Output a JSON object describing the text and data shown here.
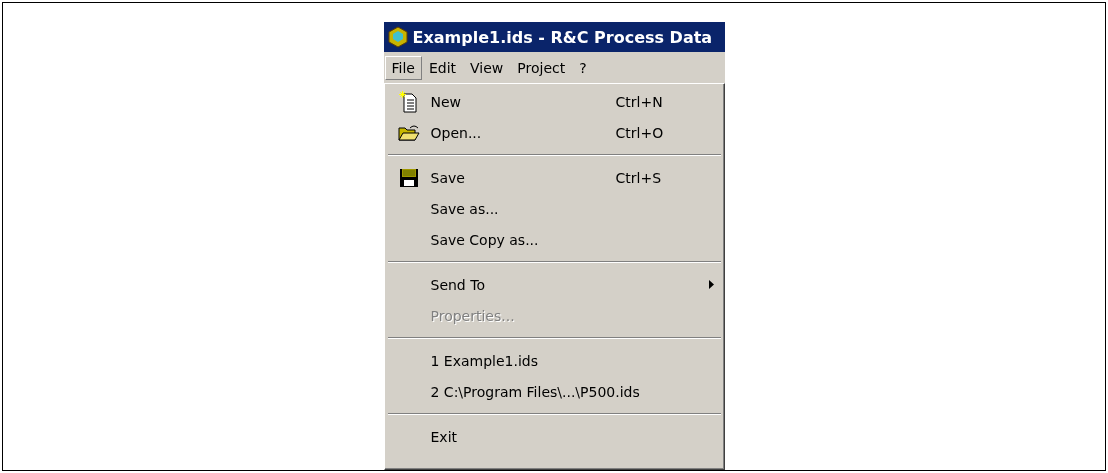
{
  "window": {
    "title": "Example1.ids - R&C Process Data"
  },
  "menubar": [
    {
      "label": "File",
      "selected": true
    },
    {
      "label": "Edit",
      "selected": false
    },
    {
      "label": "View",
      "selected": false
    },
    {
      "label": "Project",
      "selected": false
    },
    {
      "label": "?",
      "selected": false
    }
  ],
  "menu": [
    {
      "kind": "new",
      "label": "New",
      "shortcut": "Ctrl+N",
      "disabled": false,
      "submenu": false
    },
    {
      "kind": "open",
      "label": "Open...",
      "shortcut": "Ctrl+O",
      "disabled": false,
      "submenu": false
    },
    {
      "kind": "separator"
    },
    {
      "kind": "save",
      "label": "Save",
      "shortcut": "Ctrl+S",
      "disabled": false,
      "submenu": false
    },
    {
      "kind": "item",
      "label": "Save as...",
      "disabled": false,
      "submenu": false
    },
    {
      "kind": "item",
      "label": "Save Copy as...",
      "disabled": false,
      "submenu": false
    },
    {
      "kind": "separator"
    },
    {
      "kind": "item",
      "label": "Send To",
      "disabled": false,
      "submenu": true
    },
    {
      "kind": "item",
      "label": "Properties...",
      "disabled": true,
      "submenu": false
    },
    {
      "kind": "separator"
    },
    {
      "kind": "item",
      "label": "1 Example1.ids",
      "disabled": false,
      "submenu": false
    },
    {
      "kind": "item",
      "label": "2 C:\\Program Files\\...\\P500.ids",
      "disabled": false,
      "submenu": false
    },
    {
      "kind": "separator"
    },
    {
      "kind": "item",
      "label": "Exit",
      "disabled": false,
      "submenu": false
    }
  ]
}
